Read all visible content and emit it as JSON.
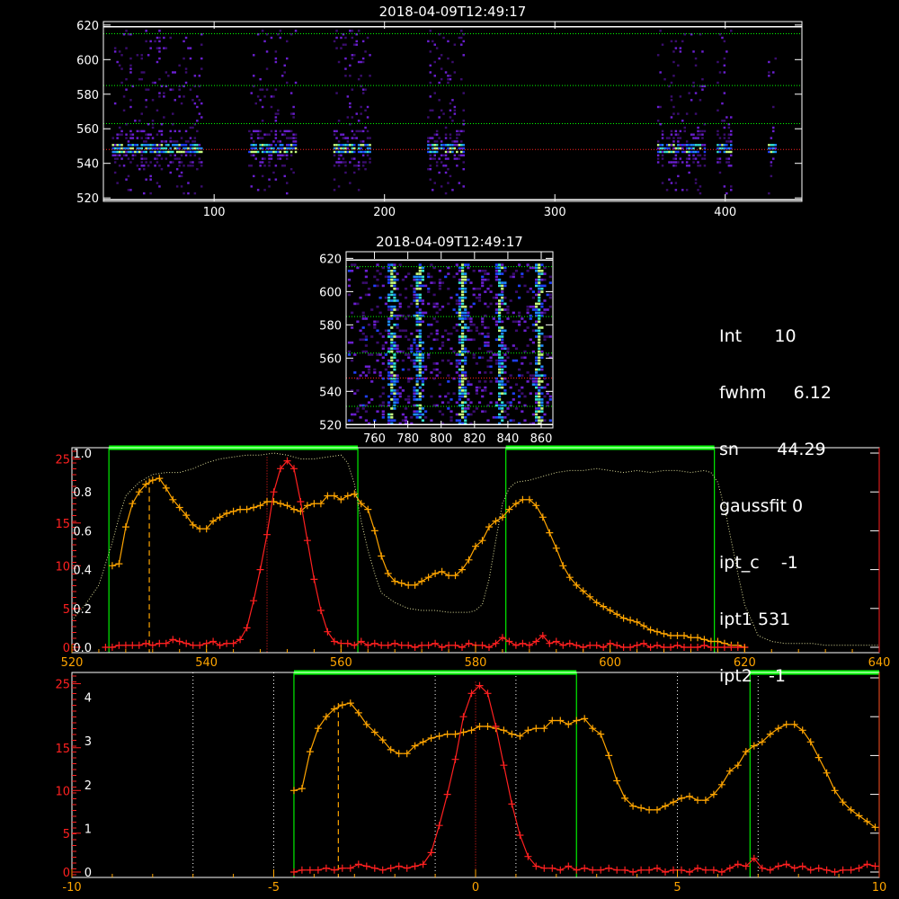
{
  "timestamps": {
    "top": "2018-04-09T12:49:17",
    "mid": "2018-04-09T12:49:17"
  },
  "info": [
    {
      "label": "Int",
      "value": "10"
    },
    {
      "label": "fwhm",
      "value": "6.12"
    },
    {
      "label": "sn",
      "value": "44.29"
    },
    {
      "label": "gaussfit",
      "value": "0"
    },
    {
      "label": "ipt_c",
      "value": "-1"
    },
    {
      "label": "ipt1",
      "value": "531"
    },
    {
      "label": "ipt2",
      "value": "-1"
    }
  ],
  "colors": {
    "background": "#000000",
    "axes": "#ffffff",
    "orange": "#ffa500",
    "red": "#ff2020",
    "green": "#00ff00",
    "window": "#00ee00",
    "guide": "#dddd99"
  },
  "chart_data": [
    {
      "id": "top-image",
      "type": "heatmap",
      "title": "2018-04-09T12:49:17",
      "xlim": [
        35,
        445
      ],
      "ylim": [
        518,
        622
      ],
      "x_ticks": [
        100,
        200,
        300,
        400
      ],
      "y_ticks": [
        520,
        540,
        560,
        580,
        600,
        620
      ],
      "hlines_white": [
        519,
        619
      ],
      "hlines_green_dotted": [
        563,
        585,
        615
      ],
      "hline_red_dotted": 548,
      "blob_x_ranges": [
        [
          40,
          92
        ],
        [
          120,
          148
        ],
        [
          170,
          192
        ],
        [
          225,
          246
        ],
        [
          360,
          388
        ],
        [
          395,
          404
        ],
        [
          425,
          430
        ]
      ],
      "colormap": "black-purple-blue-green"
    },
    {
      "id": "mid-image",
      "type": "heatmap",
      "title": "2018-04-09T12:49:17",
      "xlim": [
        743,
        867
      ],
      "ylim": [
        518,
        624
      ],
      "x_ticks": [
        760,
        780,
        800,
        820,
        840,
        860
      ],
      "y_ticks": [
        520,
        540,
        560,
        580,
        600,
        620
      ],
      "hlines_white": [
        520,
        619
      ],
      "hlines_green_dotted": [
        531,
        563,
        585,
        615
      ],
      "hline_red_dotted": 548,
      "bright_columns_x": [
        770,
        786,
        812,
        835,
        858
      ],
      "colormap": "black-purple-blue-green"
    },
    {
      "id": "spectrum-wavelength",
      "type": "line",
      "xlim": [
        520,
        640
      ],
      "x_ticks": [
        520,
        540,
        560,
        580,
        600,
        620,
        640
      ],
      "y_left_red_ticks": [
        "0",
        "5",
        "10",
        "15",
        "25"
      ],
      "y_left_white_ticks": [
        "0.0",
        "0.2",
        "0.4",
        "0.6",
        "0.8",
        "1.0"
      ],
      "green_windows": [
        [
          525.5,
          562.5
        ],
        [
          584.5,
          615.5
        ]
      ],
      "orange_dashed_x": 531.5,
      "red_dotted_x": 549,
      "series": [
        {
          "color": "orange",
          "x": [
            526,
            527,
            528,
            529,
            530,
            531,
            532,
            533,
            534,
            535,
            536,
            537,
            538,
            539,
            540,
            541,
            542,
            543,
            544,
            545,
            546,
            547,
            548,
            549,
            550,
            551,
            552,
            553,
            554,
            555,
            556,
            557,
            558,
            559,
            560,
            561,
            562,
            563,
            564,
            565,
            566,
            567,
            568,
            569,
            570,
            571,
            572,
            573,
            574,
            575,
            576,
            577,
            578,
            579,
            580,
            581,
            582,
            583,
            584,
            585,
            586,
            587,
            588,
            589,
            590,
            591,
            592,
            593,
            594,
            595,
            596,
            597,
            598,
            599,
            600,
            601,
            602,
            603,
            604,
            605,
            606,
            607,
            608,
            609,
            610,
            611,
            612,
            613,
            614,
            615,
            616,
            617,
            618,
            619,
            620
          ],
          "y": [
            0.42,
            0.43,
            0.62,
            0.74,
            0.8,
            0.84,
            0.86,
            0.87,
            0.82,
            0.76,
            0.72,
            0.68,
            0.63,
            0.61,
            0.61,
            0.65,
            0.67,
            0.69,
            0.7,
            0.71,
            0.71,
            0.72,
            0.73,
            0.75,
            0.75,
            0.74,
            0.73,
            0.71,
            0.7,
            0.73,
            0.74,
            0.74,
            0.78,
            0.78,
            0.76,
            0.78,
            0.79,
            0.74,
            0.71,
            0.6,
            0.47,
            0.38,
            0.34,
            0.33,
            0.32,
            0.32,
            0.34,
            0.36,
            0.38,
            0.39,
            0.37,
            0.37,
            0.4,
            0.45,
            0.52,
            0.55,
            0.62,
            0.65,
            0.67,
            0.71,
            0.74,
            0.76,
            0.76,
            0.73,
            0.67,
            0.59,
            0.51,
            0.42,
            0.36,
            0.32,
            0.29,
            0.26,
            0.23,
            0.21,
            0.19,
            0.17,
            0.15,
            0.14,
            0.13,
            0.11,
            0.09,
            0.08,
            0.07,
            0.06,
            0.06,
            0.06,
            0.05,
            0.05,
            0.04,
            0.03,
            0.03,
            0.02,
            0.01,
            0.01,
            0.0
          ]
        },
        {
          "color": "red",
          "x": [
            525,
            526,
            527,
            528,
            529,
            530,
            531,
            532,
            533,
            534,
            535,
            536,
            537,
            538,
            539,
            540,
            541,
            542,
            543,
            544,
            545,
            546,
            547,
            548,
            549,
            550,
            551,
            552,
            553,
            554,
            555,
            556,
            557,
            558,
            559,
            560,
            561,
            562,
            563,
            564,
            565,
            566,
            567,
            568,
            569,
            570,
            571,
            572,
            573,
            574,
            575,
            576,
            577,
            578,
            579,
            580,
            581,
            582,
            583,
            584,
            585,
            586,
            587,
            588,
            589,
            590,
            591,
            592,
            593,
            594,
            595,
            596,
            597,
            598,
            599,
            600,
            601,
            602,
            603,
            604,
            605,
            606,
            607,
            608,
            609,
            610,
            611,
            612,
            613,
            614,
            615,
            616,
            617,
            618,
            619,
            620
          ],
          "y": [
            0.0,
            0.0,
            0.01,
            0.01,
            0.01,
            0.01,
            0.02,
            0.01,
            0.02,
            0.02,
            0.04,
            0.03,
            0.02,
            0.01,
            0.01,
            0.02,
            0.03,
            0.01,
            0.02,
            0.02,
            0.04,
            0.1,
            0.24,
            0.4,
            0.58,
            0.8,
            0.92,
            0.96,
            0.92,
            0.75,
            0.55,
            0.35,
            0.19,
            0.08,
            0.03,
            0.02,
            0.02,
            0.01,
            0.03,
            0.01,
            0.02,
            0.01,
            0.01,
            0.02,
            0.01,
            0.01,
            0.0,
            0.01,
            0.01,
            0.02,
            0.0,
            0.01,
            0.01,
            0.0,
            0.02,
            0.01,
            0.01,
            0.0,
            0.02,
            0.05,
            0.03,
            0.01,
            0.02,
            0.01,
            0.03,
            0.06,
            0.02,
            0.03,
            0.01,
            0.02,
            0.01,
            0.0,
            0.01,
            0.01,
            0.0,
            0.02,
            0.01,
            0.0,
            0.0,
            0.01,
            0.02,
            0.0,
            0.01,
            0.0,
            0.0,
            0.01,
            0.0,
            0.0,
            0.0,
            0.01,
            0.0,
            0.0,
            0.0,
            0.0,
            0.0,
            0.0
          ]
        },
        {
          "color": "guide-dotted",
          "x": [
            520,
            522,
            524,
            526,
            527,
            528,
            530,
            532,
            534,
            536,
            538,
            540,
            542,
            544,
            546,
            548,
            550,
            552,
            554,
            556,
            558,
            560,
            561,
            562,
            563,
            564,
            565,
            566,
            568,
            570,
            572,
            574,
            576,
            578,
            579,
            580,
            581,
            582,
            583,
            584,
            585,
            586,
            588,
            590,
            592,
            594,
            596,
            598,
            600,
            602,
            604,
            606,
            608,
            610,
            612,
            614,
            615,
            616,
            617,
            618,
            619,
            620,
            622,
            624,
            626,
            628,
            630,
            632,
            634,
            636,
            638,
            640
          ],
          "y": [
            0.14,
            0.22,
            0.32,
            0.54,
            0.67,
            0.78,
            0.85,
            0.89,
            0.9,
            0.9,
            0.92,
            0.95,
            0.97,
            0.98,
            0.99,
            0.99,
            1.0,
            0.99,
            0.97,
            0.97,
            0.98,
            0.99,
            0.95,
            0.84,
            0.65,
            0.5,
            0.38,
            0.28,
            0.23,
            0.2,
            0.19,
            0.19,
            0.18,
            0.18,
            0.18,
            0.19,
            0.22,
            0.35,
            0.55,
            0.74,
            0.82,
            0.85,
            0.86,
            0.88,
            0.9,
            0.91,
            0.91,
            0.92,
            0.91,
            0.9,
            0.91,
            0.9,
            0.91,
            0.91,
            0.9,
            0.91,
            0.9,
            0.85,
            0.72,
            0.55,
            0.38,
            0.22,
            0.06,
            0.03,
            0.02,
            0.02,
            0.02,
            0.01,
            0.01,
            0.01,
            0.01,
            0.01
          ]
        }
      ]
    },
    {
      "id": "spectrum-velocity",
      "type": "line",
      "xlim": [
        -10,
        10
      ],
      "x_ticks": [
        -10,
        -5,
        0,
        5,
        10
      ],
      "y_left_red_ticks": [
        "0",
        "5",
        "10",
        "15",
        "25"
      ],
      "y_left_white_ticks": [
        "0",
        "1",
        "2",
        "3",
        "4"
      ],
      "green_windows": [
        [
          -4.5,
          2.5
        ],
        [
          6.8,
          10
        ]
      ],
      "orange_dashed_x": -3.4,
      "red_dotted_x": 0,
      "white_dotted_x": [
        -7,
        -5,
        -1,
        1,
        5,
        7
      ],
      "series": [
        {
          "color": "orange",
          "x": [
            -4.5,
            -4.3,
            -4.1,
            -3.9,
            -3.7,
            -3.5,
            -3.3,
            -3.1,
            -2.9,
            -2.7,
            -2.5,
            -2.3,
            -2.1,
            -1.9,
            -1.7,
            -1.5,
            -1.3,
            -1.1,
            -0.9,
            -0.7,
            -0.5,
            -0.3,
            -0.1,
            0.1,
            0.3,
            0.5,
            0.7,
            0.9,
            1.1,
            1.3,
            1.5,
            1.7,
            1.9,
            2.1,
            2.3,
            2.5,
            2.7,
            2.9,
            3.1,
            3.3,
            3.5,
            3.7,
            3.9,
            4.1,
            4.3,
            4.5,
            4.7,
            4.9,
            5.1,
            5.3,
            5.5,
            5.7,
            5.9,
            6.1,
            6.3,
            6.5,
            6.7,
            6.9,
            7.1,
            7.3,
            7.5,
            7.7,
            7.9,
            8.1,
            8.3,
            8.5,
            8.7,
            8.9,
            9.1,
            9.3,
            9.5,
            9.7,
            9.9
          ],
          "y": [
            0.42,
            0.43,
            0.62,
            0.74,
            0.8,
            0.84,
            0.86,
            0.87,
            0.82,
            0.76,
            0.72,
            0.68,
            0.63,
            0.61,
            0.61,
            0.65,
            0.67,
            0.69,
            0.7,
            0.71,
            0.71,
            0.72,
            0.73,
            0.75,
            0.75,
            0.74,
            0.73,
            0.71,
            0.7,
            0.73,
            0.74,
            0.74,
            0.78,
            0.78,
            0.76,
            0.78,
            0.79,
            0.74,
            0.71,
            0.6,
            0.47,
            0.38,
            0.34,
            0.33,
            0.32,
            0.32,
            0.34,
            0.36,
            0.38,
            0.39,
            0.37,
            0.37,
            0.4,
            0.45,
            0.52,
            0.55,
            0.62,
            0.65,
            0.67,
            0.71,
            0.74,
            0.76,
            0.76,
            0.73,
            0.67,
            0.59,
            0.51,
            0.42,
            0.36,
            0.32,
            0.29,
            0.26,
            0.23
          ]
        },
        {
          "color": "red",
          "x": [
            -4.5,
            -4.3,
            -4.1,
            -3.9,
            -3.7,
            -3.5,
            -3.3,
            -3.1,
            -2.9,
            -2.7,
            -2.5,
            -2.3,
            -2.1,
            -1.9,
            -1.7,
            -1.5,
            -1.3,
            -1.1,
            -0.9,
            -0.7,
            -0.5,
            -0.3,
            -0.1,
            0.1,
            0.3,
            0.5,
            0.7,
            0.9,
            1.1,
            1.3,
            1.5,
            1.7,
            1.9,
            2.1,
            2.3,
            2.5,
            2.7,
            2.9,
            3.1,
            3.3,
            3.5,
            3.7,
            3.9,
            4.1,
            4.3,
            4.5,
            4.7,
            4.9,
            5.1,
            5.3,
            5.5,
            5.7,
            5.9,
            6.1,
            6.3,
            6.5,
            6.7,
            6.9,
            7.1,
            7.3,
            7.5,
            7.7,
            7.9,
            8.1,
            8.3,
            8.5,
            8.7,
            8.9,
            9.1,
            9.3,
            9.5,
            9.7,
            9.9
          ],
          "y": [
            0.0,
            0.01,
            0.01,
            0.01,
            0.02,
            0.01,
            0.02,
            0.02,
            0.04,
            0.03,
            0.02,
            0.01,
            0.02,
            0.03,
            0.02,
            0.03,
            0.04,
            0.1,
            0.24,
            0.4,
            0.58,
            0.8,
            0.92,
            0.96,
            0.92,
            0.75,
            0.55,
            0.35,
            0.19,
            0.08,
            0.03,
            0.02,
            0.02,
            0.01,
            0.03,
            0.01,
            0.02,
            0.01,
            0.01,
            0.02,
            0.01,
            0.01,
            0.0,
            0.01,
            0.01,
            0.02,
            0.0,
            0.01,
            0.01,
            0.0,
            0.02,
            0.01,
            0.01,
            0.0,
            0.02,
            0.04,
            0.03,
            0.07,
            0.02,
            0.01,
            0.03,
            0.04,
            0.02,
            0.03,
            0.01,
            0.02,
            0.01,
            0.0,
            0.01,
            0.01,
            0.02,
            0.04,
            0.03
          ]
        }
      ]
    }
  ]
}
